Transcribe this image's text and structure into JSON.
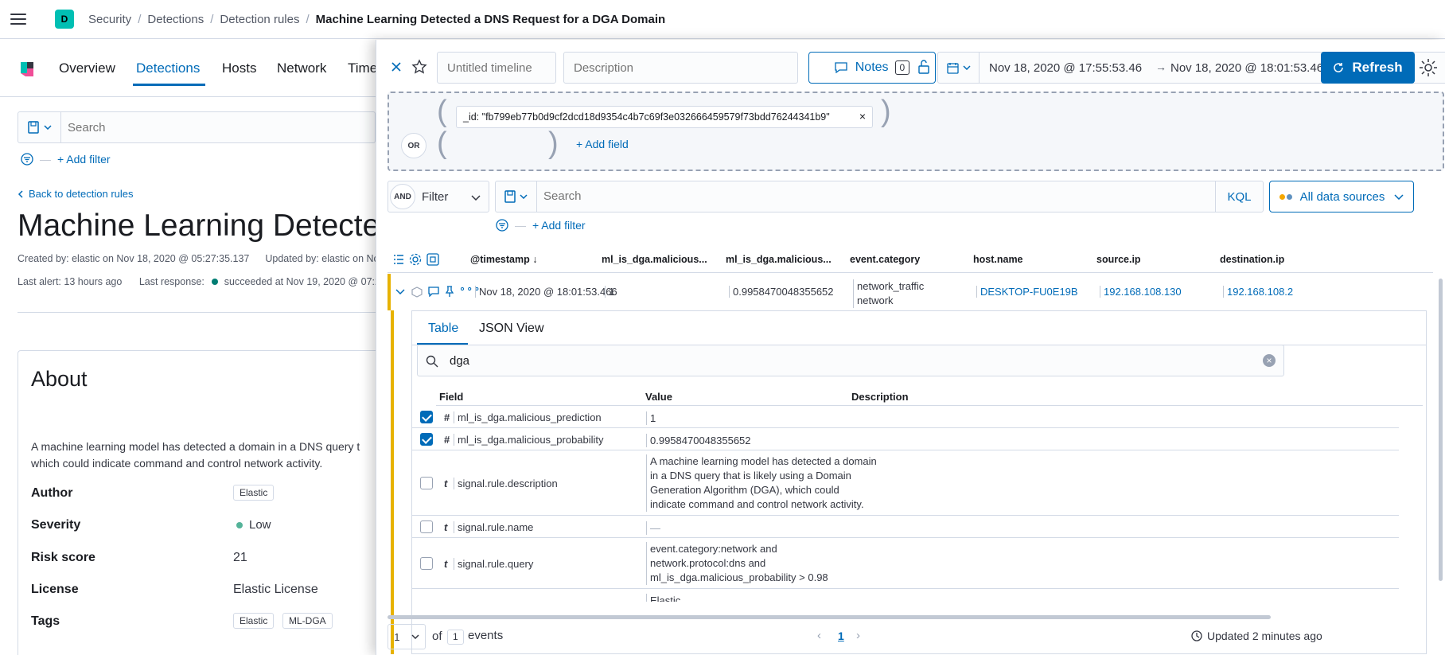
{
  "header": {
    "space_initial": "D",
    "breadcrumbs": [
      "Security",
      "Detections",
      "Detection rules"
    ],
    "breadcrumb_current": "Machine Learning Detected a DNS Request for a DGA Domain"
  },
  "left": {
    "nav_tabs": [
      "Overview",
      "Detections",
      "Hosts",
      "Network",
      "Time"
    ],
    "search_placeholder": "Search",
    "add_filter": "+ Add filter",
    "back_link": "Back to detection rules",
    "title": "Machine Learning Detected",
    "created_by": "Created by: elastic on Nov 18, 2020 @ 05:27:35.137",
    "updated_by": "Updated by: elastic on Nc",
    "last_alert": "Last alert: 13 hours ago",
    "last_response_label": "Last response:",
    "last_response_value": "succeeded at Nov 19, 2020 @ 07:2",
    "about_title": "About",
    "about_desc_1": "A machine learning model has detected a domain in a DNS query t",
    "about_desc_2": "which could indicate command and control network activity.",
    "author_label": "Author",
    "author_value": "Elastic",
    "severity_label": "Severity",
    "severity_value": "Low",
    "risk_label": "Risk score",
    "risk_value": "21",
    "license_label": "License",
    "license_value": "Elastic License",
    "tags_label": "Tags",
    "tags": [
      "Elastic",
      "ML-DGA"
    ]
  },
  "timeline": {
    "title_placeholder": "Untitled timeline",
    "description_placeholder": "Description",
    "notes_label": "Notes",
    "notes_count": "0",
    "date_start": "Nov 18, 2020 @ 17:55:53.46",
    "date_end": "Nov 18, 2020 @ 18:01:53.46",
    "refresh_label": "Refresh",
    "or_label": "OR",
    "and_label": "AND",
    "provider_chip": "_id: \"fb799eb77b0d9cf2dcd18d9354c4b7c69f3e032666459579f73bdd76244341b9\"",
    "add_field": "+ Add field",
    "filter_label": "Filter",
    "search_placeholder": "Search",
    "kql_label": "KQL",
    "data_sources": "All data sources",
    "add_filter": "+ Add filter",
    "columns": [
      "@timestamp",
      "ml_is_dga.malicious...",
      "ml_is_dga.malicious...",
      "event.category",
      "host.name",
      "source.ip",
      "destination.ip"
    ],
    "row": {
      "timestamp": "Nov 18, 2020 @ 18:01:53.466",
      "prediction": "1",
      "probability": "0.9958470048355652",
      "category_1": "network_traffic",
      "category_2": "network",
      "host": "DESKTOP-FU0E19B",
      "source_ip": "192.168.108.130",
      "dest_ip": "192.168.108.2"
    },
    "detail_tabs": [
      "Table",
      "JSON View"
    ],
    "detail_search": "dga",
    "detail_headers": [
      "Field",
      "Value",
      "Description"
    ],
    "fields": [
      {
        "type": "#",
        "name": "ml_is_dga.malicious_prediction",
        "value": "1",
        "checked": true
      },
      {
        "type": "#",
        "name": "ml_is_dga.malicious_probability",
        "value": "0.9958470048355652",
        "checked": true
      },
      {
        "type": "t",
        "name": "signal.rule.description",
        "value": "A machine learning model has detected a domain in a DNS query that is likely using a Domain Generation Algorithm (DGA), which could indicate command and control network activity.",
        "checked": false
      },
      {
        "type": "t",
        "name": "signal.rule.name",
        "value": "—",
        "checked": false
      },
      {
        "type": "t",
        "name": "signal.rule.query",
        "value": "event.category:network and network.protocol:dns and ml_is_dga.malicious_probability > 0.98",
        "checked": false
      },
      {
        "type": "",
        "name": "",
        "value": "Elastic",
        "checked": false
      }
    ],
    "footer": {
      "rows_per_page": "1",
      "of_label": "of",
      "total": "1",
      "events_label": "events",
      "page": "1",
      "updated": "Updated 2 minutes ago"
    }
  },
  "colors": {
    "accent": "#006bb8",
    "space": "#00bfb3",
    "row_highlight": "#e7b200",
    "success": "#017d73",
    "severity_low": "#54b399"
  }
}
